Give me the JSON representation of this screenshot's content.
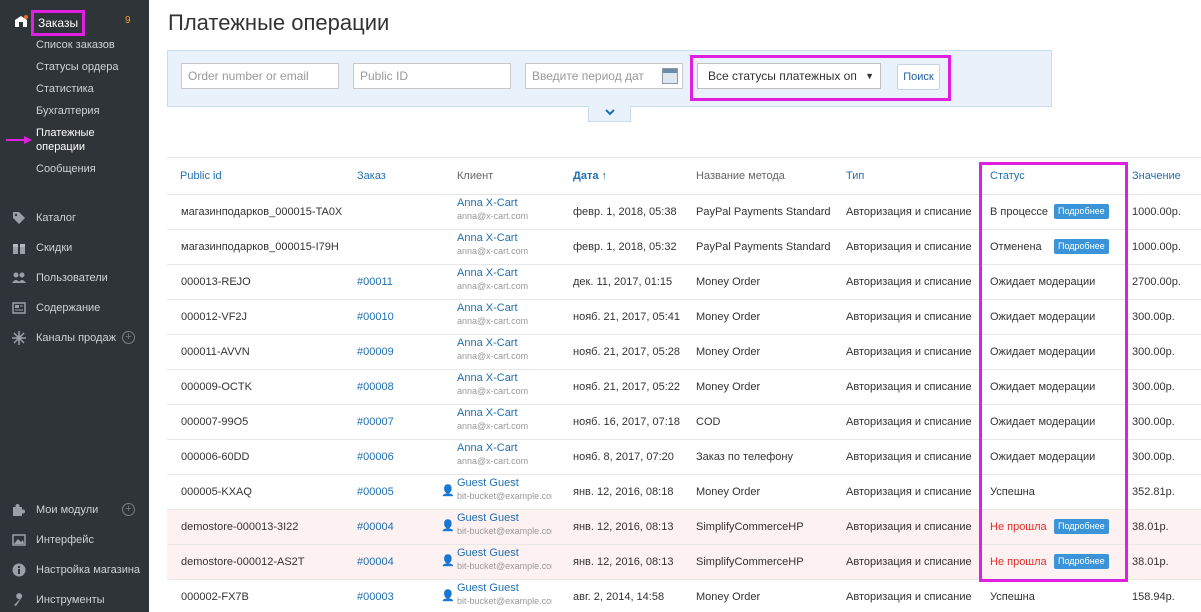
{
  "sidebar": {
    "orders_label": "Заказы",
    "orders_badge": "9",
    "subitems": [
      "Список заказов",
      "Статусы ордера",
      "Статистика",
      "Бухгалтерия",
      "Платежные\nоперации",
      "Сообщения"
    ],
    "active_subitem": "Платежные операции",
    "nav": [
      {
        "label": "Каталог",
        "icon": "tag-icon"
      },
      {
        "label": "Скидки",
        "icon": "gift-icon"
      },
      {
        "label": "Пользователи",
        "icon": "users-icon"
      },
      {
        "label": "Содержание",
        "icon": "content-icon"
      },
      {
        "label": "Каналы продаж",
        "icon": "channels-icon",
        "plus": true
      }
    ],
    "nav_bottom": [
      {
        "label": "Мои модули",
        "icon": "puzzle-icon",
        "plus": true
      },
      {
        "label": "Интерфейс",
        "icon": "image-icon"
      },
      {
        "label": "Настройка магазина",
        "icon": "info-icon"
      },
      {
        "label": "Инструменты",
        "icon": "wrench-icon"
      }
    ]
  },
  "page": {
    "title": "Платежные операции"
  },
  "filters": {
    "order_placeholder": "Order number or email",
    "public_id_placeholder": "Public ID",
    "period_placeholder": "Введите период дат",
    "status_select": "Все статусы платежных оп",
    "search_label": "Поиск"
  },
  "table": {
    "headers": {
      "public_id": "Public id",
      "order": "Заказ",
      "client": "Клиент",
      "date": "Дата ↑",
      "method": "Название метода",
      "type": "Тип",
      "status": "Статус",
      "value": "Значение"
    },
    "more_label": "Подробнее",
    "rows": [
      {
        "public_id": "магазинподарков_000015-TA0X",
        "order": "",
        "client": "Anna X-Cart",
        "email": "anna@x-cart.com",
        "guest": false,
        "date": "февр. 1, 2018, 05:38",
        "method": "PayPal Payments Standard",
        "type": "Авторизация и списание",
        "status": "В процессе",
        "status_color": "normal",
        "more": true,
        "value": "1000.00р."
      },
      {
        "public_id": "магазинподарков_000015-I79H",
        "order": "",
        "client": "Anna X-Cart",
        "email": "anna@x-cart.com",
        "guest": false,
        "date": "февр. 1, 2018, 05:32",
        "method": "PayPal Payments Standard",
        "type": "Авторизация и списание",
        "status": "Отменена",
        "status_color": "normal",
        "more": true,
        "value": "1000.00р."
      },
      {
        "public_id": "000013-REJO",
        "order": "#00011",
        "client": "Anna X-Cart",
        "email": "anna@x-cart.com",
        "guest": false,
        "date": "дек. 11, 2017, 01:15",
        "method": "Money Order",
        "type": "Авторизация и списание",
        "status": "Ожидает модерации",
        "status_color": "normal",
        "more": false,
        "value": "2700.00р."
      },
      {
        "public_id": "000012-VF2J",
        "order": "#00010",
        "client": "Anna X-Cart",
        "email": "anna@x-cart.com",
        "guest": false,
        "date": "нояб. 21, 2017, 05:41",
        "method": "Money Order",
        "type": "Авторизация и списание",
        "status": "Ожидает модерации",
        "status_color": "normal",
        "more": false,
        "value": "300.00р."
      },
      {
        "public_id": "000011-AVVN",
        "order": "#00009",
        "client": "Anna X-Cart",
        "email": "anna@x-cart.com",
        "guest": false,
        "date": "нояб. 21, 2017, 05:28",
        "method": "Money Order",
        "type": "Авторизация и списание",
        "status": "Ожидает модерации",
        "status_color": "normal",
        "more": false,
        "value": "300.00р."
      },
      {
        "public_id": "000009-OCTK",
        "order": "#00008",
        "client": "Anna X-Cart",
        "email": "anna@x-cart.com",
        "guest": false,
        "date": "нояб. 21, 2017, 05:22",
        "method": "Money Order",
        "type": "Авторизация и списание",
        "status": "Ожидает модерации",
        "status_color": "normal",
        "more": false,
        "value": "300.00р."
      },
      {
        "public_id": "000007-99O5",
        "order": "#00007",
        "client": "Anna X-Cart",
        "email": "anna@x-cart.com",
        "guest": false,
        "date": "нояб. 16, 2017, 07:18",
        "method": "COD",
        "type": "Авторизация и списание",
        "status": "Ожидает модерации",
        "status_color": "normal",
        "more": false,
        "value": "300.00р."
      },
      {
        "public_id": "000006-60DD",
        "order": "#00006",
        "client": "Anna X-Cart",
        "email": "anna@x-cart.com",
        "guest": false,
        "date": "нояб. 8, 2017, 07:20",
        "method": "Заказ по телефону",
        "type": "Авторизация и списание",
        "status": "Ожидает модерации",
        "status_color": "normal",
        "more": false,
        "value": "300.00р."
      },
      {
        "public_id": "000005-KXAQ",
        "order": "#00005",
        "client": "Guest Guest",
        "email": "bit-bucket@example.com",
        "guest": true,
        "date": "янв. 12, 2016, 08:18",
        "method": "Money Order",
        "type": "Авторизация и списание",
        "status": "Успешна",
        "status_color": "normal",
        "more": false,
        "value": "352.81р."
      },
      {
        "public_id": "demostore-000013-3I22",
        "order": "#00004",
        "client": "Guest Guest",
        "email": "bit-bucket@example.com",
        "guest": true,
        "date": "янв. 12, 2016, 08:13",
        "method": "SimplifyCommerceHP",
        "type": "Авторизация и списание",
        "status": "Не прошла",
        "status_color": "red",
        "more": true,
        "value": "38.01р."
      },
      {
        "public_id": "demostore-000012-AS2T",
        "order": "#00004",
        "client": "Guest Guest",
        "email": "bit-bucket@example.com",
        "guest": true,
        "date": "янв. 12, 2016, 08:13",
        "method": "SimplifyCommerceHP",
        "type": "Авторизация и списание",
        "status": "Не прошла",
        "status_color": "red",
        "more": true,
        "value": "38.01р."
      },
      {
        "public_id": "000002-FX7B",
        "order": "#00003",
        "client": "Guest Guest",
        "email": "bit-bucket@example.com",
        "guest": true,
        "date": "авг. 2, 2014, 14:58",
        "method": "Money Order",
        "type": "Авторизация и списание",
        "status": "Успешна",
        "status_color": "normal",
        "more": false,
        "value": "158.94р."
      }
    ]
  },
  "colors": {
    "sidebar_bg": "#2f3438",
    "link": "#1f6fb0",
    "highlight": "#e020e0",
    "fail_row": "#fdf1f1",
    "fail_text": "#e0302a",
    "more_btn": "#3b94d8"
  }
}
